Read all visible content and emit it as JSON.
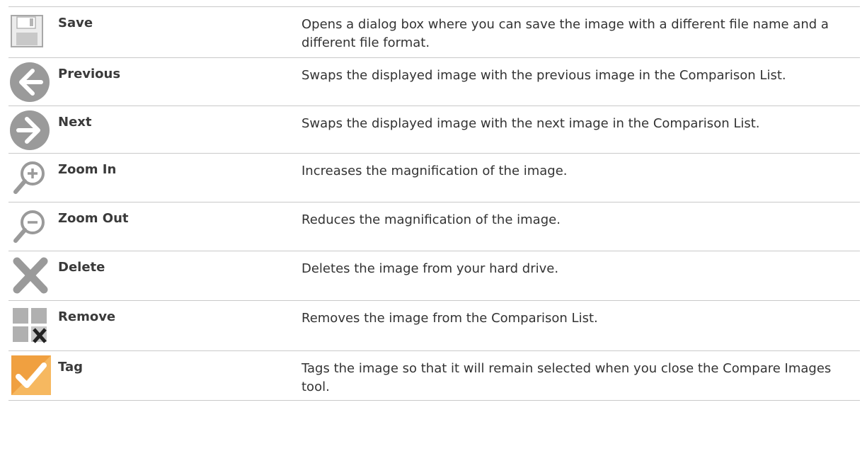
{
  "rows": [
    {
      "icon": "save-disk-icon",
      "name": "Save",
      "description": "Opens a dialog box where you can save the image with a different file name and a different file format."
    },
    {
      "icon": "previous-arrow-icon",
      "name": "Previous",
      "description": "Swaps the displayed image with the previous image in the Comparison List."
    },
    {
      "icon": "next-arrow-icon",
      "name": "Next",
      "description": "Swaps the displayed image with the next image in the Comparison List."
    },
    {
      "icon": "zoom-in-icon",
      "name": "Zoom In",
      "description": "Increases the magnification of the image."
    },
    {
      "icon": "zoom-out-icon",
      "name": "Zoom Out",
      "description": "Reduces the magnification of the image."
    },
    {
      "icon": "delete-x-icon",
      "name": "Delete",
      "description": "Deletes the image from your hard drive."
    },
    {
      "icon": "remove-grid-icon",
      "name": "Remove",
      "description": "Removes the image from the Comparison List."
    },
    {
      "icon": "tag-check-icon",
      "name": "Tag",
      "description": "Tags the image so that it will remain selected when you close the Compare Images tool."
    }
  ],
  "colors": {
    "icon_gray": "#9a9a9a",
    "tag_orange": "#f0a040",
    "border": "#c9c9c9"
  }
}
